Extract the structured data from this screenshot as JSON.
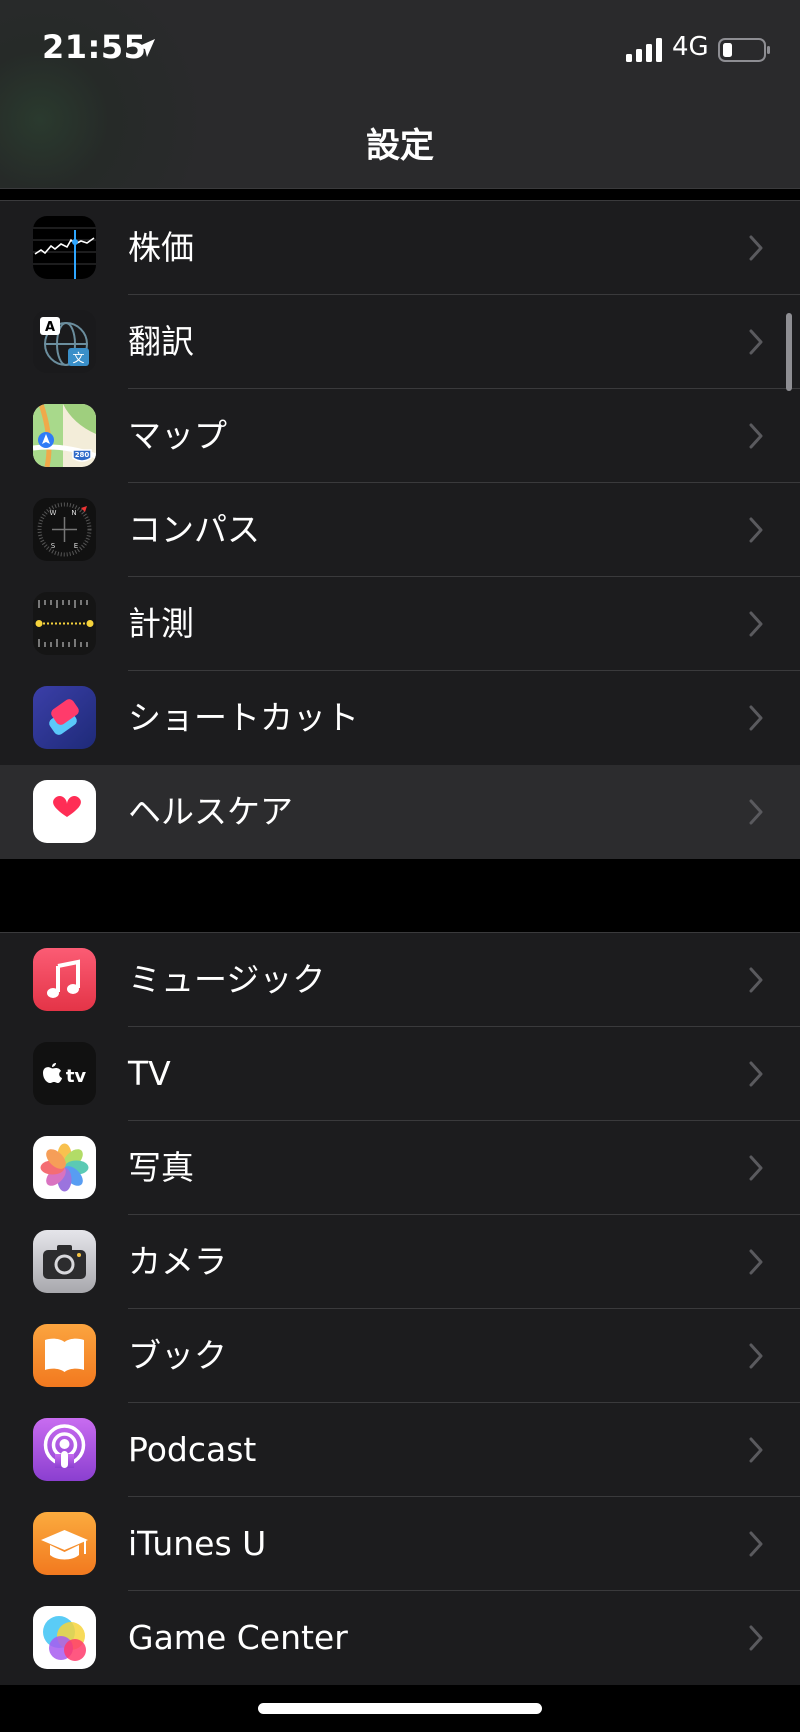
{
  "status_bar": {
    "time": "21:55",
    "network": "4G"
  },
  "nav": {
    "title": "設定"
  },
  "group1": [
    {
      "label": "株価",
      "icon": "stocks-icon"
    },
    {
      "label": "翻訳",
      "icon": "translate-icon"
    },
    {
      "label": "マップ",
      "icon": "maps-icon"
    },
    {
      "label": "コンパス",
      "icon": "compass-icon"
    },
    {
      "label": "計測",
      "icon": "measure-icon"
    },
    {
      "label": "ショートカット",
      "icon": "shortcuts-icon"
    },
    {
      "label": "ヘルスケア",
      "icon": "health-icon",
      "highlighted": true
    }
  ],
  "group2": [
    {
      "label": "ミュージック",
      "icon": "music-icon"
    },
    {
      "label": "TV",
      "icon": "tv-icon"
    },
    {
      "label": "写真",
      "icon": "photos-icon"
    },
    {
      "label": "カメラ",
      "icon": "camera-icon"
    },
    {
      "label": "ブック",
      "icon": "books-icon"
    },
    {
      "label": "Podcast",
      "icon": "podcasts-icon"
    },
    {
      "label": "iTunes U",
      "icon": "itunes-u-icon"
    },
    {
      "label": "Game Center",
      "icon": "game-center-icon"
    }
  ],
  "icon_text": {
    "translate_a": "A",
    "translate_bun": "文",
    "maps_shield": "280",
    "compass_n": "N",
    "compass_s": "S",
    "compass_e": "E",
    "compass_w": "W",
    "tv_text": "tv"
  },
  "colors": {
    "background": "#000000",
    "cell": "#1c1c1e",
    "cell_highlight": "#2c2c2e",
    "separator": "#3a3a3c",
    "chevron": "#5a5a5e"
  }
}
